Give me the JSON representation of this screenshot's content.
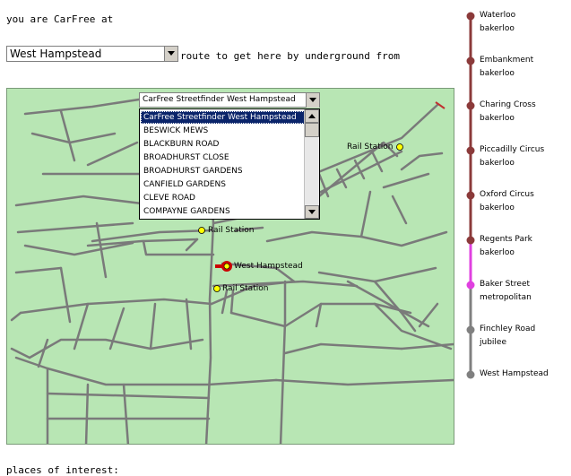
{
  "intro": "you are CarFree at",
  "station_select": {
    "value": "West Hampstead"
  },
  "route_text": "route to get here by underground from",
  "places_text": "places of interest:",
  "street_select": {
    "value": "CarFree Streetfinder West Hampstead",
    "options": [
      "CarFree Streetfinder West Hampstead",
      "BESWICK MEWS",
      "BLACKBURN ROAD",
      "BROADHURST CLOSE",
      "BROADHURST GARDENS",
      "CANFIELD GARDENS",
      "CLEVE ROAD",
      "COMPAYNE GARDENS"
    ]
  },
  "map": {
    "labels": {
      "rail1": "Rail Station",
      "rail2": "Rail Station",
      "rail3": "Rail Station",
      "current": "West Hampstead"
    }
  },
  "route": {
    "stops": [
      {
        "name": "Waterloo",
        "line": "bakerloo",
        "color": "#8b3a3a"
      },
      {
        "name": "Embankment",
        "line": "bakerloo",
        "color": "#8b3a3a"
      },
      {
        "name": "Charing Cross",
        "line": "bakerloo",
        "color": "#8b3a3a"
      },
      {
        "name": "Piccadilly Circus",
        "line": "bakerloo",
        "color": "#8b3a3a"
      },
      {
        "name": "Oxford Circus",
        "line": "bakerloo",
        "color": "#8b3a3a"
      },
      {
        "name": "Regents Park",
        "line": "bakerloo",
        "color": "#8b3a3a"
      },
      {
        "name": "Baker Street",
        "line": "metropolitan",
        "color": "#e040e0"
      },
      {
        "name": "Finchley Road",
        "line": "jubilee",
        "color": "#808080"
      },
      {
        "name": "West Hampstead",
        "line": "",
        "color": "#808080"
      }
    ]
  },
  "colors": {
    "map_bg": "#b8e6b4",
    "roads": "#7a7a7a",
    "bakerloo": "#8b3a3a",
    "metropolitan": "#e040e0",
    "jubilee": "#808080"
  }
}
